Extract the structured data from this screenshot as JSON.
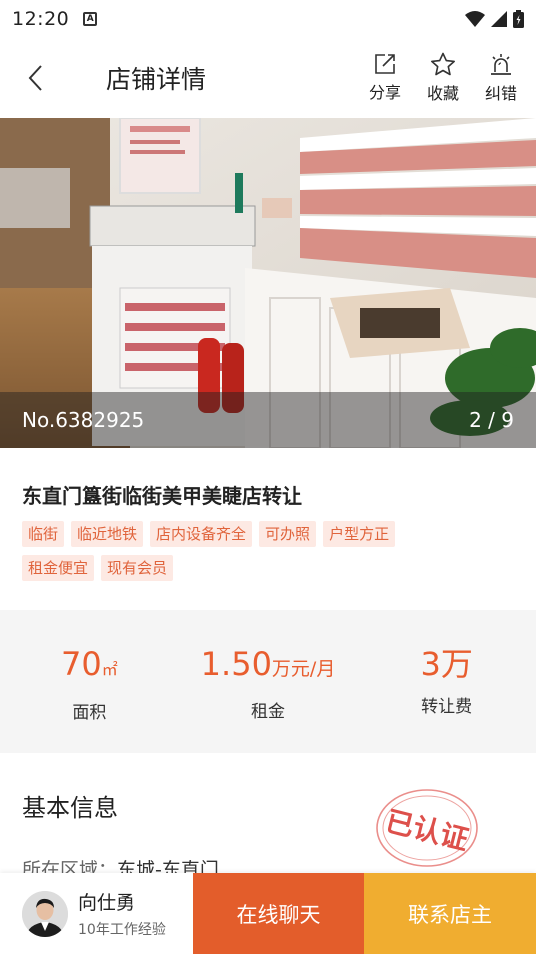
{
  "status_bar": {
    "time": "12:20",
    "notif_icon": "A"
  },
  "nav": {
    "title": "店铺详情",
    "actions": [
      {
        "label": "分享",
        "icon": "share-icon"
      },
      {
        "label": "收藏",
        "icon": "star-icon"
      },
      {
        "label": "纠错",
        "icon": "alarm-icon"
      }
    ]
  },
  "hero": {
    "listing_no": "No.6382925",
    "counter": "2 / 9"
  },
  "listing": {
    "title": "东直门簋街临街美甲美睫店转让",
    "tags": [
      "临街",
      "临近地铁",
      "店内设备齐全",
      "可办照",
      "户型方正",
      "租金便宜",
      "现有会员"
    ]
  },
  "stats": {
    "area": {
      "value": "70",
      "unit": "㎡",
      "label": "面积"
    },
    "rent": {
      "value": "1.50",
      "unit": "万元/月",
      "label": "租金"
    },
    "fee": {
      "value": "3",
      "unit": "万",
      "label": "转让费"
    }
  },
  "basic": {
    "title": "基本信息",
    "area_label": "所在区域：",
    "area_value": "东城-东直门",
    "stamp_text": "已认证"
  },
  "bottom": {
    "agent_name": "向仕勇",
    "agent_experience": "10年工作经验",
    "chat_label": "在线聊天",
    "contact_label": "联系店主"
  },
  "colors": {
    "accent": "#e35d2b",
    "contact": "#f0ad30",
    "tag_bg": "#fde9e3",
    "tag_text": "#e0643c",
    "value": "#e85d2e"
  }
}
